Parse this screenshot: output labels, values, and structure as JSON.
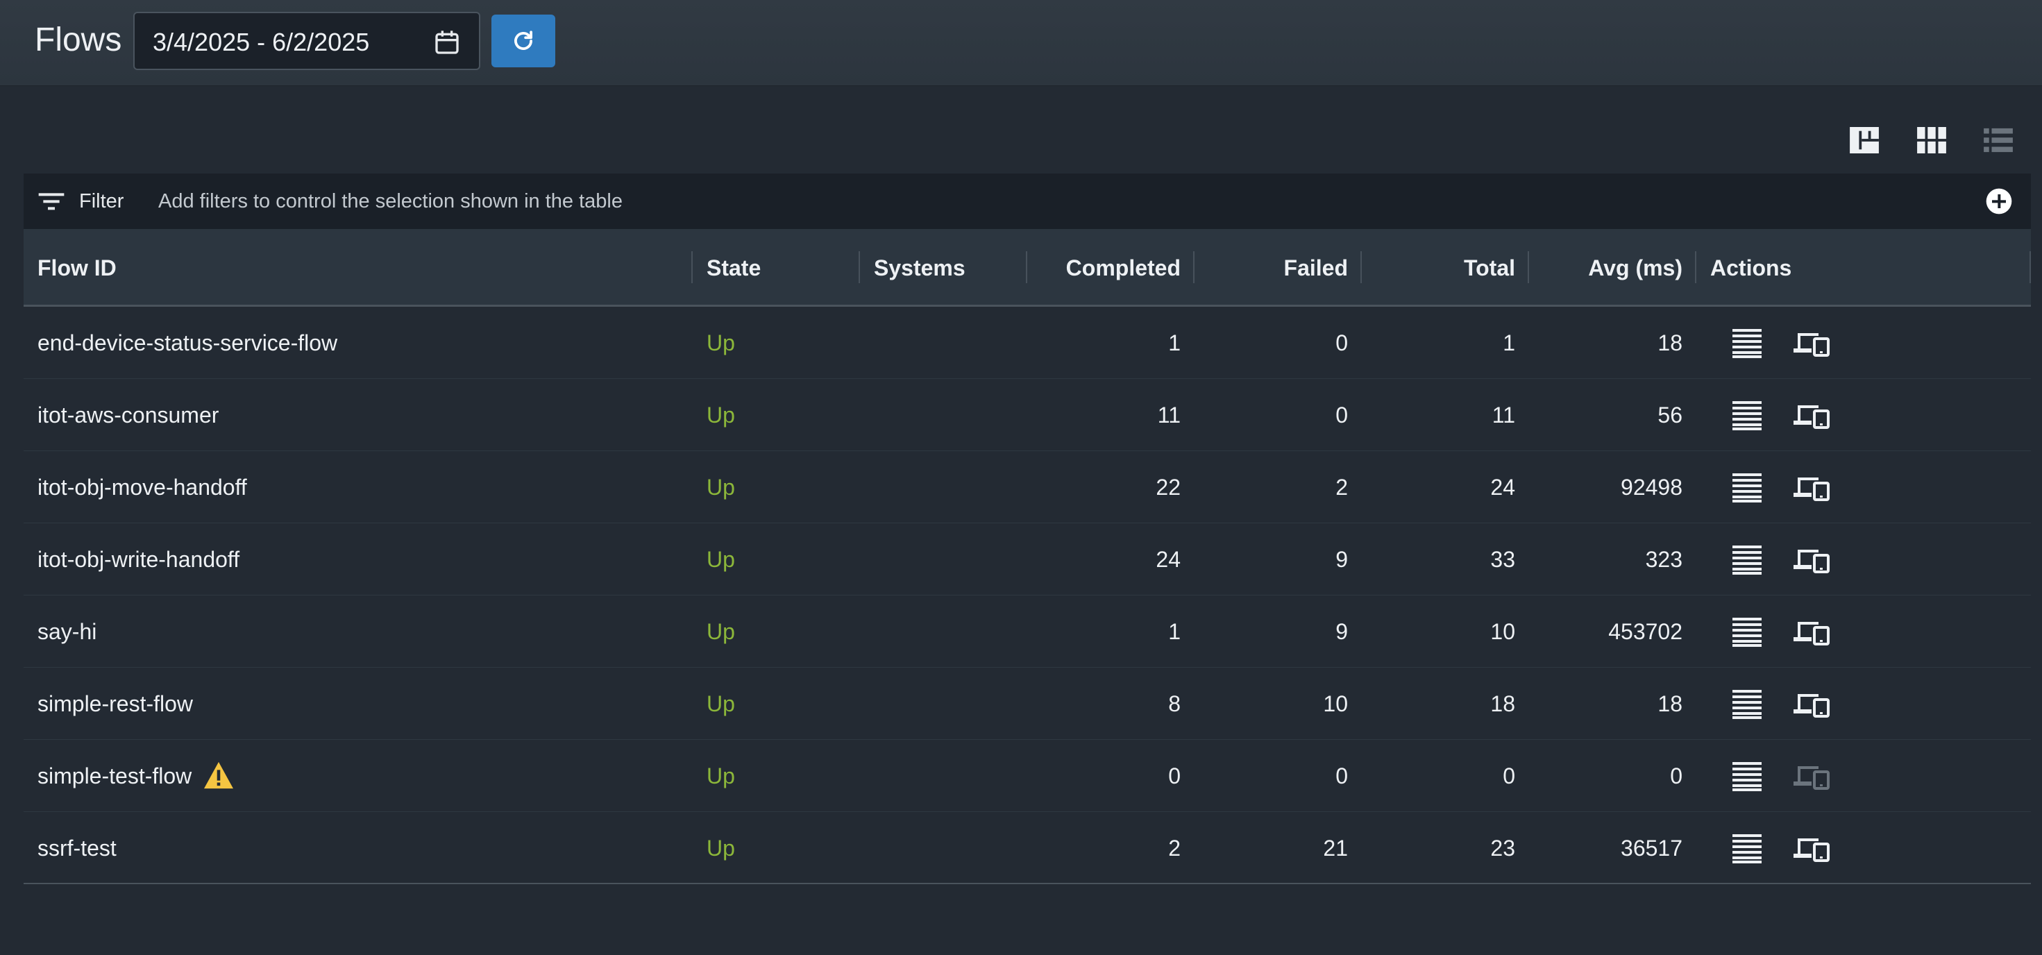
{
  "header": {
    "title": "Flows",
    "date_range": "3/4/2025 - 6/2/2025"
  },
  "filter": {
    "label": "Filter",
    "hint": "Add filters to control the selection shown in the table"
  },
  "table": {
    "columns": [
      "Flow ID",
      "State",
      "Systems",
      "Completed",
      "Failed",
      "Total",
      "Avg (ms)",
      "Actions"
    ],
    "rows": [
      {
        "flow_id": "end-device-status-service-flow",
        "state": "Up",
        "systems": "",
        "completed": "1",
        "failed": "0",
        "total": "1",
        "avg": "18",
        "warning": false,
        "device_enabled": true
      },
      {
        "flow_id": "itot-aws-consumer",
        "state": "Up",
        "systems": "",
        "completed": "11",
        "failed": "0",
        "total": "11",
        "avg": "56",
        "warning": false,
        "device_enabled": true
      },
      {
        "flow_id": "itot-obj-move-handoff",
        "state": "Up",
        "systems": "",
        "completed": "22",
        "failed": "2",
        "total": "24",
        "avg": "92498",
        "warning": false,
        "device_enabled": true
      },
      {
        "flow_id": "itot-obj-write-handoff",
        "state": "Up",
        "systems": "",
        "completed": "24",
        "failed": "9",
        "total": "33",
        "avg": "323",
        "warning": false,
        "device_enabled": true
      },
      {
        "flow_id": "say-hi",
        "state": "Up",
        "systems": "",
        "completed": "1",
        "failed": "9",
        "total": "10",
        "avg": "453702",
        "warning": false,
        "device_enabled": true
      },
      {
        "flow_id": "simple-rest-flow",
        "state": "Up",
        "systems": "",
        "completed": "8",
        "failed": "10",
        "total": "18",
        "avg": "18",
        "warning": false,
        "device_enabled": true
      },
      {
        "flow_id": "simple-test-flow",
        "state": "Up",
        "systems": "",
        "completed": "0",
        "failed": "0",
        "total": "0",
        "avg": "0",
        "warning": true,
        "device_enabled": false
      },
      {
        "flow_id": "ssrf-test",
        "state": "Up",
        "systems": "",
        "completed": "2",
        "failed": "21",
        "total": "23",
        "avg": "36517",
        "warning": false,
        "device_enabled": true
      }
    ]
  },
  "icons": {
    "calendar": "calendar-icon",
    "refresh": "refresh-icon",
    "filter": "filter-icon",
    "add": "add-circle-icon",
    "view_dashboard": "dashboard-view-icon",
    "view_grid": "grid-view-icon",
    "view_list": "list-view-icon",
    "details": "details-list-icon",
    "devices": "devices-icon",
    "warning": "warning-icon"
  },
  "colors": {
    "accent": "#2f7bbf",
    "state_up": "#8cb73a",
    "warning": "#f5c542"
  }
}
